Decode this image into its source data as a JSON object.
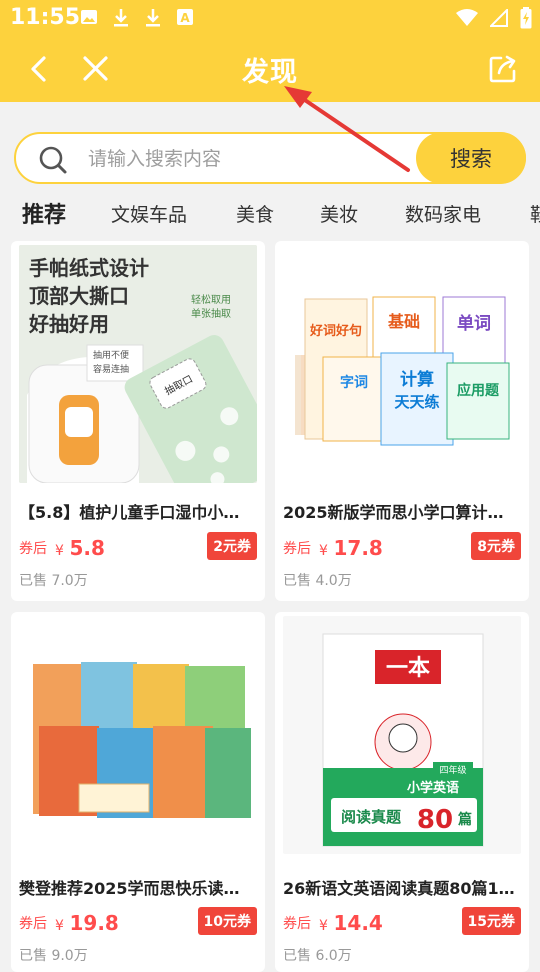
{
  "status": {
    "time": "11:55"
  },
  "nav": {
    "title": "发现"
  },
  "search": {
    "placeholder": "请输入搜索内容",
    "button": "搜索"
  },
  "tabs": [
    "推荐",
    "文娱车品",
    "美食",
    "美妆",
    "数码家电",
    "鞋"
  ],
  "products": [
    {
      "title": "【5.8】植护儿童手口湿巾小…",
      "coupon_label": "券后",
      "currency": "¥",
      "price": "5.8",
      "coupon": "2元券",
      "sold": "已售 7.0万",
      "image_text": {
        "line1": "手帕纸式设计",
        "line2": "顶部大撕口",
        "line3": "好抽好用",
        "tag1": "轻松取用",
        "tag2": "单张抽取",
        "tag3": "抽用不便",
        "tag4": "容易连抽",
        "tag5": "抽取口"
      }
    },
    {
      "title": "2025新版学而思小学口算计…",
      "coupon_label": "券后",
      "currency": "¥",
      "price": "17.8",
      "coupon": "8元券",
      "sold": "已售 4.0万",
      "image_text": {
        "b1": "好词好句",
        "b2": "基础",
        "b3": "单词",
        "b4": "字词",
        "b5": "计算",
        "b6": "应用题",
        "sub": "天天练"
      }
    },
    {
      "title": "樊登推荐2025学而思快乐读…",
      "coupon_label": "券后",
      "currency": "¥",
      "price": "19.8",
      "coupon": "10元券",
      "sold": "已售 9.0万",
      "image_text": {}
    },
    {
      "title": "26新语文英语阅读真题80篇1…",
      "coupon_label": "券后",
      "currency": "¥",
      "price": "14.4",
      "coupon": "15元券",
      "sold": "已售 6.0万",
      "image_text": {
        "brand": "一本",
        "grade": "四年级",
        "subject": "小学英语",
        "main": "阅读真题",
        "num": "80",
        "unit": "篇"
      }
    }
  ],
  "colors": {
    "brand": "#fdd23d",
    "price": "#ff4c4c",
    "badge": "#f0453a",
    "arrow": "#e53935"
  }
}
